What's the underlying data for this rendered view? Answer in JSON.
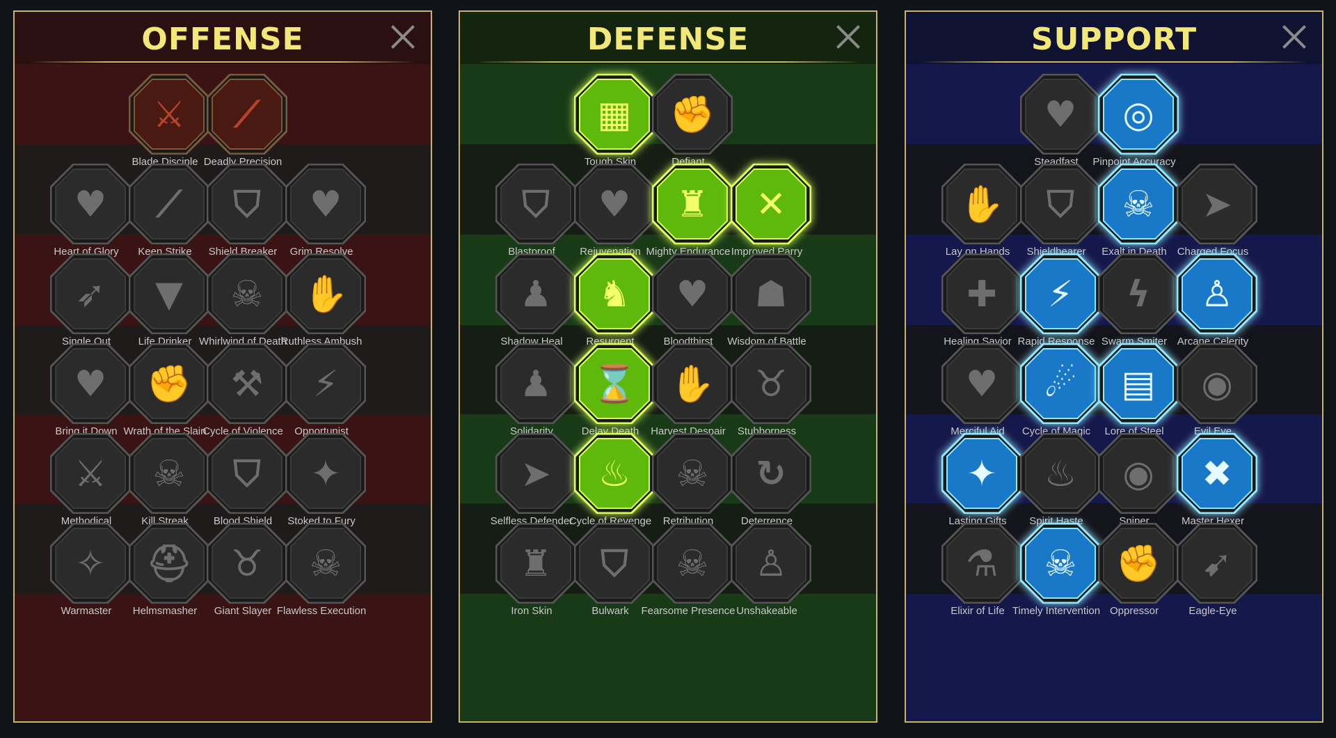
{
  "colors": {
    "title": "#f3e777",
    "border": "#c9b56a",
    "label": "#c9c9c9",
    "inactive_fill": "#2b2b2b",
    "inactive_edge": "#555555",
    "inactive_glyph": "#6e6e6e",
    "offense_active_fill": "#4a1a12",
    "offense_active_glyph": "#b8432b",
    "defense_active_fill": "#5fb90d",
    "defense_active_edge": "#d9ff5a",
    "defense_active_glyph": "#f3ff6a",
    "support_active_fill": "#1a78c9",
    "support_active_edge": "#8fe8ff",
    "support_active_glyph": "#e6fbff"
  },
  "panels": [
    {
      "key": "offense",
      "title": "OFFENSE",
      "close_icon": "close-icon",
      "top_row": [
        {
          "name": "Blade Disciple",
          "icon": "crossed-swords-icon",
          "glyph": "⚔",
          "state": "active"
        },
        {
          "name": "Deadly Precision",
          "icon": "dagger-slash-icon",
          "glyph": "⟋",
          "state": "active"
        }
      ],
      "rows": [
        [
          {
            "name": "Heart of Glory",
            "icon": "horned-helm-heart-icon",
            "glyph": "♥",
            "state": "inactive"
          },
          {
            "name": "Keen Strike",
            "icon": "blade-slash-icon",
            "glyph": "⟋",
            "state": "inactive"
          },
          {
            "name": "Shield Breaker",
            "icon": "broken-shield-icon",
            "glyph": "⛉",
            "state": "inactive"
          },
          {
            "name": "Grim Resolve",
            "icon": "dripping-heart-icon",
            "glyph": "♥",
            "state": "inactive"
          }
        ],
        [
          {
            "name": "Single Out",
            "icon": "arrows-target-icon",
            "glyph": "➶",
            "state": "inactive"
          },
          {
            "name": "Life Drinker",
            "icon": "fangs-icon",
            "glyph": "▼",
            "state": "inactive"
          },
          {
            "name": "Whirlwind of Death",
            "icon": "skull-whirl-icon",
            "glyph": "☠",
            "state": "inactive"
          },
          {
            "name": "Ruthless Ambush",
            "icon": "hand-dagger-icon",
            "glyph": "✋",
            "state": "inactive"
          }
        ],
        [
          {
            "name": "Bring it Down",
            "icon": "sword-heart-icon",
            "glyph": "♥",
            "state": "inactive"
          },
          {
            "name": "Wrath of the Slain",
            "icon": "fist-sword-icon",
            "glyph": "✊",
            "state": "inactive"
          },
          {
            "name": "Cycle of Violence",
            "icon": "axe-cycle-icon",
            "glyph": "⚒",
            "state": "inactive"
          },
          {
            "name": "Opportunist",
            "icon": "chain-lightning-icon",
            "glyph": "⚡",
            "state": "inactive"
          }
        ],
        [
          {
            "name": "Methodical",
            "icon": "crossed-weapons-icon",
            "glyph": "⚔",
            "state": "inactive"
          },
          {
            "name": "Kill Streak",
            "icon": "skulls-icon",
            "glyph": "☠",
            "state": "inactive"
          },
          {
            "name": "Blood Shield",
            "icon": "sword-shield-icon",
            "glyph": "⛉",
            "state": "inactive"
          },
          {
            "name": "Stoked to Fury",
            "icon": "raging-warrior-icon",
            "glyph": "✦",
            "state": "inactive"
          }
        ],
        [
          {
            "name": "Warmaster",
            "icon": "sword-sparkles-icon",
            "glyph": "✧",
            "state": "inactive"
          },
          {
            "name": "Helmsmasher",
            "icon": "cracked-helm-icon",
            "glyph": "⛑",
            "state": "inactive"
          },
          {
            "name": "Giant Slayer",
            "icon": "horned-giant-icon",
            "glyph": "♉",
            "state": "inactive"
          },
          {
            "name": "Flawless Execution",
            "icon": "crowned-skull-icon",
            "glyph": "☠",
            "state": "inactive"
          }
        ]
      ]
    },
    {
      "key": "defense",
      "title": "DEFENSE",
      "close_icon": "close-icon",
      "top_row": [
        {
          "name": "Tough Skin",
          "icon": "scale-plates-icon",
          "glyph": "▦",
          "state": "active"
        },
        {
          "name": "Defiant",
          "icon": "raised-fist-icon",
          "glyph": "✊",
          "state": "inactive"
        }
      ],
      "rows": [
        [
          {
            "name": "Blastproof",
            "icon": "layered-shield-icon",
            "glyph": "⛉",
            "state": "inactive"
          },
          {
            "name": "Rejuvenation",
            "icon": "anatomical-heart-icon",
            "glyph": "♥",
            "state": "inactive"
          },
          {
            "name": "Mighty Endurance",
            "icon": "armored-warrior-icon",
            "glyph": "♜",
            "state": "active"
          },
          {
            "name": "Improved Parry",
            "icon": "crossed-blades-icon",
            "glyph": "✕",
            "state": "active"
          }
        ],
        [
          {
            "name": "Shadow Heal",
            "icon": "shadow-figures-icon",
            "glyph": "♟",
            "state": "inactive"
          },
          {
            "name": "Resurgent",
            "icon": "knight-shield-icon",
            "glyph": "♞",
            "state": "active"
          },
          {
            "name": "Bloodthirst",
            "icon": "skull-heart-icon",
            "glyph": "♥",
            "state": "inactive"
          },
          {
            "name": "Wisdom of Battle",
            "icon": "hooded-sage-icon",
            "glyph": "☗",
            "state": "inactive"
          }
        ],
        [
          {
            "name": "Solidarity",
            "icon": "group-figures-icon",
            "glyph": "♟",
            "state": "inactive"
          },
          {
            "name": "Delay Death",
            "icon": "hourglass-skull-icon",
            "glyph": "⌛",
            "state": "active"
          },
          {
            "name": "Harvest Despair",
            "icon": "open-hand-icon",
            "glyph": "✋",
            "state": "inactive"
          },
          {
            "name": "Stubborness",
            "icon": "bull-head-icon",
            "glyph": "♉",
            "state": "inactive"
          }
        ],
        [
          {
            "name": "Selfless Defender",
            "icon": "dashing-defender-icon",
            "glyph": "➤",
            "state": "inactive"
          },
          {
            "name": "Cycle of Revenge",
            "icon": "blood-drops-icon",
            "glyph": "♨",
            "state": "active"
          },
          {
            "name": "Retribution",
            "icon": "spiked-skull-icon",
            "glyph": "☠",
            "state": "inactive"
          },
          {
            "name": "Deterrence",
            "icon": "hand-cycle-icon",
            "glyph": "↻",
            "state": "inactive"
          }
        ],
        [
          {
            "name": "Iron Skin",
            "icon": "iron-warrior-icon",
            "glyph": "♜",
            "state": "inactive"
          },
          {
            "name": "Bulwark",
            "icon": "winged-shield-icon",
            "glyph": "⛉",
            "state": "inactive"
          },
          {
            "name": "Fearsome Presence",
            "icon": "bearded-skull-icon",
            "glyph": "☠",
            "state": "inactive"
          },
          {
            "name": "Unshakeable",
            "icon": "flexing-figure-icon",
            "glyph": "♙",
            "state": "inactive"
          }
        ]
      ]
    },
    {
      "key": "support",
      "title": "SUPPORT",
      "close_icon": "close-icon",
      "top_row": [
        {
          "name": "Steadfast",
          "icon": "heart-plus-icon",
          "glyph": "♥",
          "state": "inactive"
        },
        {
          "name": "Pinpoint Accuracy",
          "icon": "target-burst-icon",
          "glyph": "◎",
          "state": "active"
        }
      ],
      "rows": [
        [
          {
            "name": "Lay on Hands",
            "icon": "praying-hands-icon",
            "glyph": "✋",
            "state": "inactive"
          },
          {
            "name": "Shieldbearer",
            "icon": "shield-waves-icon",
            "glyph": "⛉",
            "state": "inactive"
          },
          {
            "name": "Exalt in Death",
            "icon": "flaming-skull-icon",
            "glyph": "☠",
            "state": "active"
          },
          {
            "name": "Charged Focus",
            "icon": "hand-beam-icon",
            "glyph": "➤",
            "state": "inactive"
          }
        ],
        [
          {
            "name": "Healing Savior",
            "icon": "healing-figure-icon",
            "glyph": "✚",
            "state": "inactive"
          },
          {
            "name": "Rapid Response",
            "icon": "lightning-bolt-icon",
            "glyph": "⚡",
            "state": "active"
          },
          {
            "name": "Swarm Smiter",
            "icon": "jagged-bolt-icon",
            "glyph": "ϟ",
            "state": "inactive"
          },
          {
            "name": "Arcane Celerity",
            "icon": "speeding-figure-icon",
            "glyph": "♙",
            "state": "active"
          }
        ],
        [
          {
            "name": "Merciful Aid",
            "icon": "chained-heart-icon",
            "glyph": "♥",
            "state": "inactive"
          },
          {
            "name": "Cycle of Magic",
            "icon": "comet-cycle-icon",
            "glyph": "☄",
            "state": "active"
          },
          {
            "name": "Lore of Steel",
            "icon": "open-book-icon",
            "glyph": "▤",
            "state": "active"
          },
          {
            "name": "Evil Eye",
            "icon": "fanged-eye-icon",
            "glyph": "◉",
            "state": "inactive"
          }
        ],
        [
          {
            "name": "Lasting Gifts",
            "icon": "compass-star-icon",
            "glyph": "✦",
            "state": "active"
          },
          {
            "name": "Spirit Haste",
            "icon": "winged-boot-icon",
            "glyph": "♨",
            "state": "inactive"
          },
          {
            "name": "Sniper",
            "icon": "watching-eye-icon",
            "glyph": "◉",
            "state": "inactive"
          },
          {
            "name": "Master Hexer",
            "icon": "voodoo-doll-icon",
            "glyph": "✖",
            "state": "active"
          }
        ],
        [
          {
            "name": "Elixir of Life",
            "icon": "potion-flask-icon",
            "glyph": "⚗",
            "state": "inactive"
          },
          {
            "name": "Timely Intervention",
            "icon": "winged-skull-icon",
            "glyph": "☠",
            "state": "active"
          },
          {
            "name": "Oppressor",
            "icon": "crushing-fist-icon",
            "glyph": "✊",
            "state": "inactive"
          },
          {
            "name": "Eagle-Eye",
            "icon": "eagle-head-icon",
            "glyph": "➹",
            "state": "inactive"
          }
        ]
      ]
    }
  ]
}
